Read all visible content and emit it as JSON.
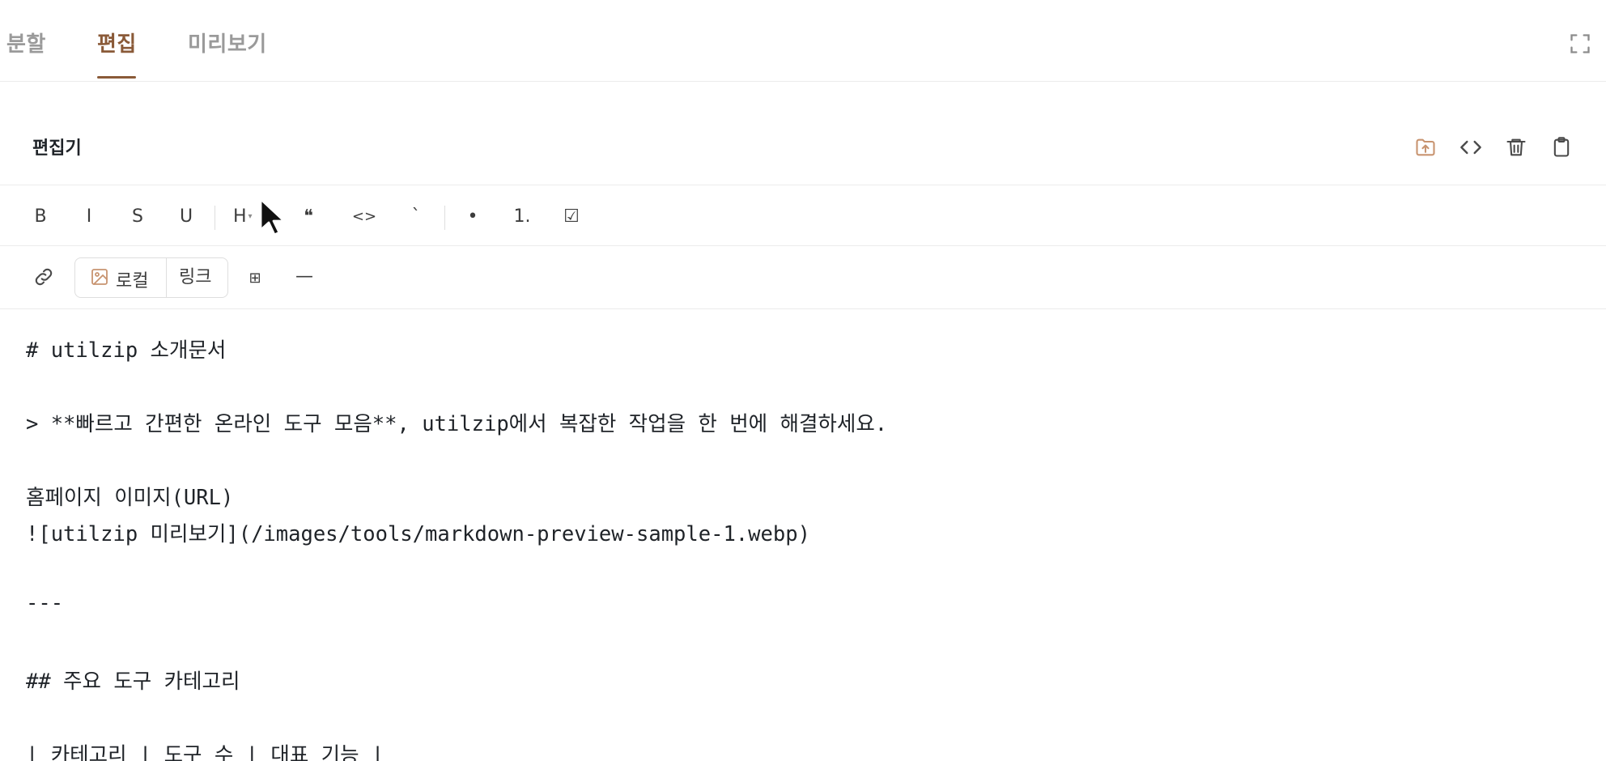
{
  "tabs": {
    "items": [
      {
        "label": "분할"
      },
      {
        "label": "편집"
      },
      {
        "label": "미리보기"
      }
    ],
    "active": "편집"
  },
  "editor": {
    "title": "편집기",
    "header_icons": [
      "folder-upload-icon",
      "code-icon",
      "trash-icon",
      "clipboard-icon"
    ]
  },
  "toolbar": {
    "bold": "B",
    "italic": "I",
    "strike": "S",
    "underline": "U",
    "heading": "H",
    "quote": "❝",
    "code_block": "<>",
    "inline_code": "`",
    "bullet_list": "•",
    "ordered_list": "1.",
    "checkbox": "☑",
    "image_local": "로컬",
    "image_link": "링크",
    "table": "⊞",
    "hr": "—"
  },
  "content": {
    "lines": [
      "# utilzip 소개문서",
      "",
      "> **빠르고 간편한 온라인 도구 모음**, utilzip에서 복잡한 작업을 한 번에 해결하세요.",
      "",
      "홈페이지 이미지(URL)",
      "![utilzip 미리보기](/images/tools/markdown-preview-sample-1.webp)",
      "",
      "---",
      "",
      "## 주요 도구 카테고리",
      "",
      "| 카테고리 | 도구 수 | 대표 기능 |"
    ]
  },
  "colors": {
    "accent": "#8a5a38",
    "accent_light": "#c89470",
    "muted": "#9a9a9a",
    "border": "#ececec"
  }
}
